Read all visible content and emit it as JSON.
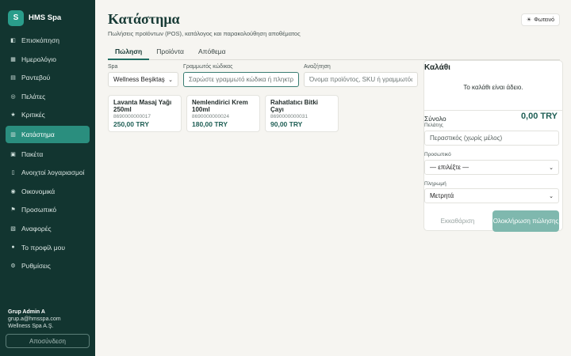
{
  "brand": {
    "logo_letter": "S",
    "name": "HMS Spa"
  },
  "nav": [
    {
      "label": "Επισκόπηση",
      "icon": "dashboard-icon",
      "glyph": "◧",
      "active": false
    },
    {
      "label": "Ημερολόγιο",
      "icon": "calendar-icon",
      "glyph": "▦",
      "active": false
    },
    {
      "label": "Ραντεβού",
      "icon": "appointments-icon",
      "glyph": "▤",
      "active": false
    },
    {
      "label": "Πελάτες",
      "icon": "customers-icon",
      "glyph": "◎",
      "active": false
    },
    {
      "label": "Κριτικές",
      "icon": "star-icon",
      "glyph": "★",
      "active": false
    },
    {
      "label": "Κατάστημα",
      "icon": "store-icon",
      "glyph": "▥",
      "active": true
    },
    {
      "label": "Πακέτα",
      "icon": "package-icon",
      "glyph": "▣",
      "active": false
    },
    {
      "label": "Ανοιχτοί λογαριασμοί",
      "icon": "receipt-icon",
      "glyph": "▯",
      "active": false
    },
    {
      "label": "Οικονομικά",
      "icon": "money-bag-icon",
      "glyph": "◉",
      "active": false
    },
    {
      "label": "Προσωπικό",
      "icon": "staff-icon",
      "glyph": "⚑",
      "active": false
    },
    {
      "label": "Αναφορές",
      "icon": "chart-icon",
      "glyph": "▧",
      "active": false
    },
    {
      "label": "Το προφίλ μου",
      "icon": "profile-icon",
      "glyph": "●",
      "active": false
    },
    {
      "label": "Ρυθμίσεις",
      "icon": "gear-icon",
      "glyph": "⚙",
      "active": false
    }
  ],
  "user": {
    "name": "Grup Admin A",
    "email": "grup.a@hmsspa.com",
    "company": "Wellness Spa A.Ş."
  },
  "logout_label": "Αποσύνδεση",
  "page": {
    "title": "Κατάστημα",
    "subtitle": "Πωλήσεις προϊόντων (POS), κατάλογος και παρακολούθηση αποθέματος",
    "theme_label": "Φωτεινό",
    "theme_glyph": "☀"
  },
  "tabs": [
    {
      "label": "Πώληση",
      "active": true
    },
    {
      "label": "Προϊόντα",
      "active": false
    },
    {
      "label": "Απόθεμα",
      "active": false
    }
  ],
  "filters": {
    "spa_label": "Spa",
    "spa_value": "Wellness Beşiktaş",
    "barcode_label": "Γραμμωτός κώδικας",
    "barcode_placeholder": "Σαρώστε γραμμωτό κώδικα ή πληκτρολογήστε",
    "search_label": "Αναζήτηση",
    "search_placeholder": "Όνομα προϊόντος, SKU ή γραμμωτός κώδικας"
  },
  "products": [
    {
      "name": "Lavanta Masaj Yağı 250ml",
      "sku": "8690000000017",
      "price": "250,00 TRY"
    },
    {
      "name": "Nemlendirici Krem 100ml",
      "sku": "8690000000024",
      "price": "180,00 TRY"
    },
    {
      "name": "Rahatlatıcı Bitki Çayı",
      "sku": "8690000000031",
      "price": "90,00 TRY"
    }
  ],
  "cart": {
    "title": "Καλάθι",
    "empty_text": "Το καλάθι είναι άδειο.",
    "total_label": "Σύνολο",
    "total_value": "0,00 TRY",
    "customer_label": "Πελάτης",
    "customer_placeholder": "Περαστικός (χωρίς μέλος)",
    "staff_label": "Προσωπικό",
    "staff_value": "— επιλέξτε —",
    "payment_label": "Πληρωμή",
    "payment_value": "Μετρητά",
    "clear_label": "Εκκαθάριση",
    "complete_label": "Ολοκλήρωση πώλησης"
  }
}
